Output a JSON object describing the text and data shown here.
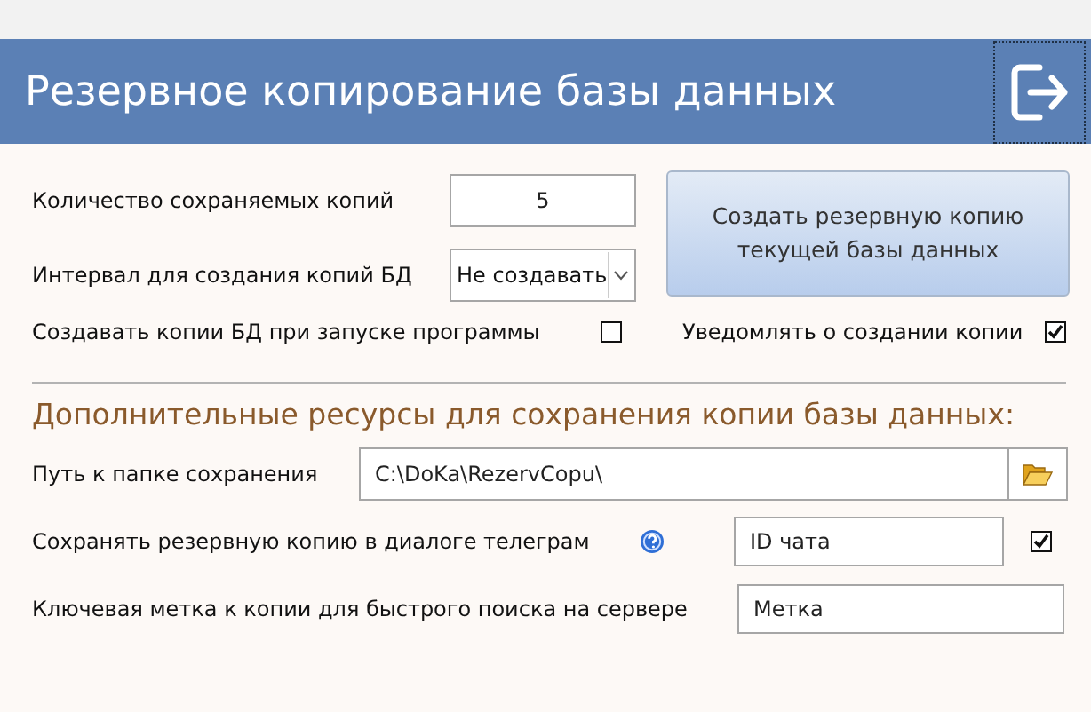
{
  "window": {
    "title": "Резервное копирование базы данных"
  },
  "copies": {
    "label": "Количество сохраняемых копий",
    "value": "5"
  },
  "interval": {
    "label": "Интервал для создания копий БД",
    "value": "Не создавать"
  },
  "backup_button": {
    "label": "Создать резервную копию текущей базы данных"
  },
  "startup": {
    "label": "Создавать копии БД при запуске программы",
    "checked": false
  },
  "notify": {
    "label": "Уведомлять о создании копии",
    "checked": true
  },
  "section_title": "Дополнительные ресурсы для сохранения копии базы данных:",
  "path": {
    "label": "Путь к папке сохранения",
    "value": "C:\\DoKa\\RezervCopu\\"
  },
  "telegram": {
    "label": "Сохранять резервную копию в диалоге телеграм",
    "value": "ID чата",
    "checked": true
  },
  "key": {
    "label": "Ключевая метка к копии для быстрого поиска на сервере",
    "value": "Метка"
  }
}
